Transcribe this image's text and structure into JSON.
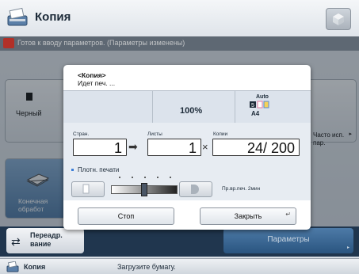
{
  "app": {
    "title": "Копия",
    "status_message": "Готов к вводу параметров. (Параметры изменены)"
  },
  "background": {
    "color_mode_label": "Черный",
    "often_used_label": "Часто исп. пар.",
    "finishing_label": "Конечная обработ",
    "redirect_label": "Переадр. вание",
    "params_label": "Параметры"
  },
  "dialog": {
    "title": "<Копия>",
    "subtitle": "Идет печ. ...",
    "zoom": "100%",
    "paper_mode": "Auto",
    "paper_size": "A4",
    "pages_label": "Стран.",
    "sheets_label": "Листы",
    "copies_label": "Копии",
    "pages_value": "1",
    "sheets_value": "1",
    "copies_value": "24/  200",
    "density_label": "Плотн. печати",
    "dry_time_label": "Пр.вр.печ. 2мин",
    "stop_label": "Стоп",
    "close_label": "Закрыть"
  },
  "statusbar": {
    "app": "Копия",
    "message": "Загрузите бумагу."
  },
  "colors": {
    "accent_blue": "#2a5580",
    "warning_red": "#d0392f",
    "bar_navy": "#20364e"
  }
}
